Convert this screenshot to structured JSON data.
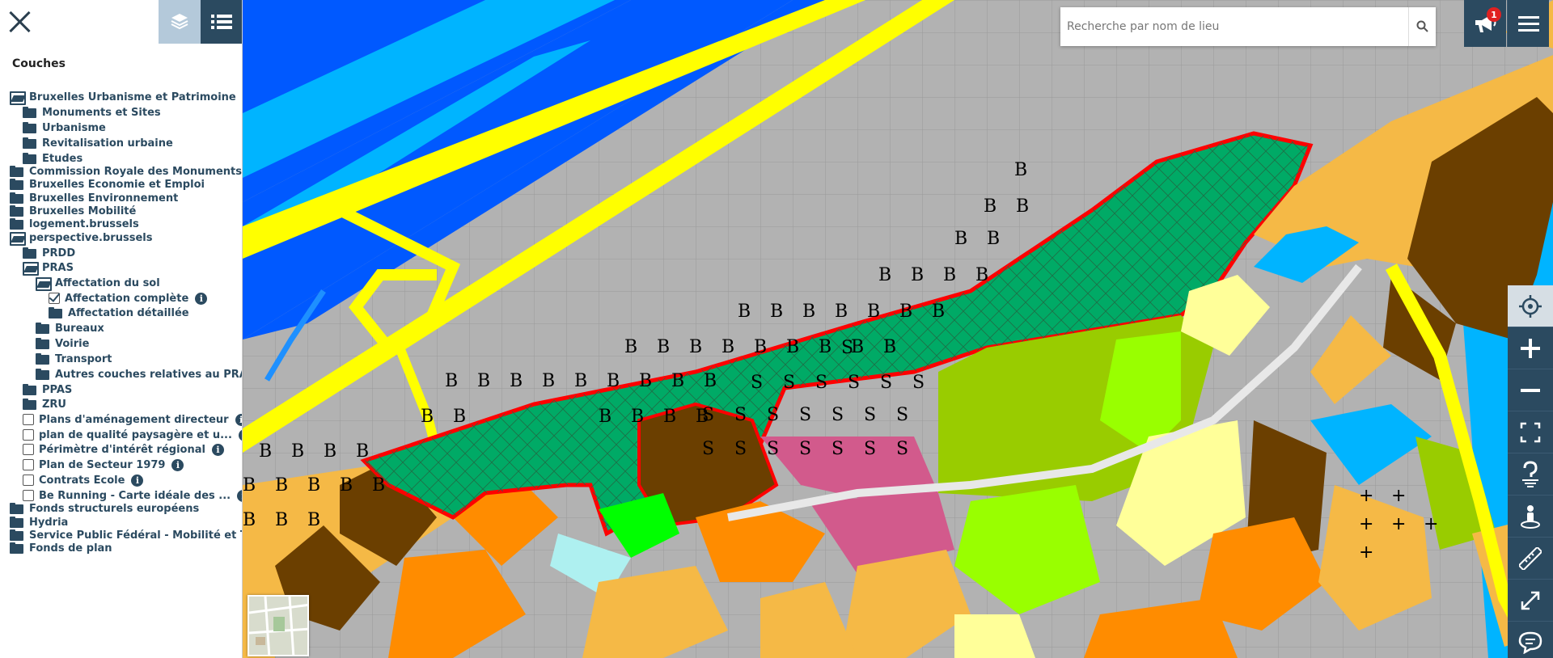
{
  "sidebar": {
    "title": "Couches",
    "tree": [
      {
        "label": "Bruxelles Urbanisme et Patrimoine",
        "icon": "folder-open-icon",
        "level": 0,
        "info": false
      },
      {
        "label": "Monuments et Sites",
        "icon": "folder-icon",
        "level": 1,
        "info": false
      },
      {
        "label": "Urbanisme",
        "icon": "folder-icon",
        "level": 1,
        "info": false
      },
      {
        "label": "Revitalisation urbaine",
        "icon": "folder-icon",
        "level": 1,
        "info": false
      },
      {
        "label": "Etudes",
        "icon": "folder-icon",
        "level": 1,
        "info": false
      },
      {
        "label": "Commission Royale des Monuments e...",
        "icon": "folder-icon",
        "level": 0,
        "info": false
      },
      {
        "label": "Bruxelles Economie et Emploi",
        "icon": "folder-icon",
        "level": 0,
        "info": false
      },
      {
        "label": "Bruxelles Environnement",
        "icon": "folder-icon",
        "level": 0,
        "info": false
      },
      {
        "label": "Bruxelles Mobilité",
        "icon": "folder-icon",
        "level": 0,
        "info": false
      },
      {
        "label": "logement.brussels",
        "icon": "folder-icon",
        "level": 0,
        "info": false
      },
      {
        "label": "perspective.brussels",
        "icon": "folder-open-icon",
        "level": 0,
        "info": false
      },
      {
        "label": "PRDD",
        "icon": "folder-icon",
        "level": 1,
        "info": false
      },
      {
        "label": "PRAS",
        "icon": "folder-open-icon",
        "level": 1,
        "info": false
      },
      {
        "label": "Affectation du sol",
        "icon": "folder-open-icon",
        "level": 2,
        "info": false
      },
      {
        "label": "Affectation complète",
        "icon": "checkbox-checked-icon",
        "level": 3,
        "info": true
      },
      {
        "label": "Affectation détaillée",
        "icon": "folder-icon",
        "level": 3,
        "info": false
      },
      {
        "label": "Bureaux",
        "icon": "folder-icon",
        "level": 2,
        "info": false
      },
      {
        "label": "Voirie",
        "icon": "folder-icon",
        "level": 2,
        "info": false
      },
      {
        "label": "Transport",
        "icon": "folder-icon",
        "level": 2,
        "info": false
      },
      {
        "label": "Autres couches relatives au PRAS",
        "icon": "folder-icon",
        "level": 2,
        "info": false
      },
      {
        "label": "PPAS",
        "icon": "folder-icon",
        "level": 1,
        "info": false
      },
      {
        "label": "ZRU",
        "icon": "folder-icon",
        "level": 1,
        "info": false
      },
      {
        "label": "Plans d'aménagement directeur",
        "icon": "checkbox-icon",
        "level": 1,
        "info": true
      },
      {
        "label": "plan de qualité paysagère et u...",
        "icon": "checkbox-icon",
        "level": 1,
        "info": true
      },
      {
        "label": "Périmètre d'intérêt régional",
        "icon": "checkbox-icon",
        "level": 1,
        "info": true
      },
      {
        "label": "Plan de Secteur 1979",
        "icon": "checkbox-icon",
        "level": 1,
        "info": true
      },
      {
        "label": "Contrats École",
        "icon": "checkbox-icon",
        "level": 1,
        "info": true
      },
      {
        "label": "Be Running - Carte idéale des ...",
        "icon": "checkbox-icon",
        "level": 1,
        "info": true
      },
      {
        "label": "Fonds structurels européens",
        "icon": "folder-icon",
        "level": 0,
        "info": false
      },
      {
        "label": "Hydria",
        "icon": "folder-icon",
        "level": 0,
        "info": false
      },
      {
        "label": "Service Public Fédéral - Mobilité et Tr...",
        "icon": "folder-icon",
        "level": 0,
        "info": false
      },
      {
        "label": "Fonds de plan",
        "icon": "folder-icon",
        "level": 0,
        "info": false
      }
    ]
  },
  "search": {
    "placeholder": "Recherche par nom de lieu"
  },
  "notifications": {
    "count": "1"
  },
  "map": {
    "zone_letter_b": "B",
    "zone_letter_s": "S",
    "cemetery_symbol": "+",
    "colors": {
      "water": "#0059ff",
      "water_light": "#00b4ff",
      "road": "#ffff00",
      "park": "#00aa66",
      "industry": "#6b3f00",
      "housing": "#f5b946",
      "mixed": "#ff8c00",
      "green": "#99ff00",
      "pink": "#d25a8c",
      "highlight": "#ff0000"
    }
  },
  "toolbar": {
    "buttons": [
      "locate-icon",
      "zoom-in-icon",
      "zoom-out-icon",
      "fullscreen-icon",
      "help-icon",
      "street-view-icon",
      "measure-icon",
      "share-icon",
      "feedback-icon"
    ]
  }
}
